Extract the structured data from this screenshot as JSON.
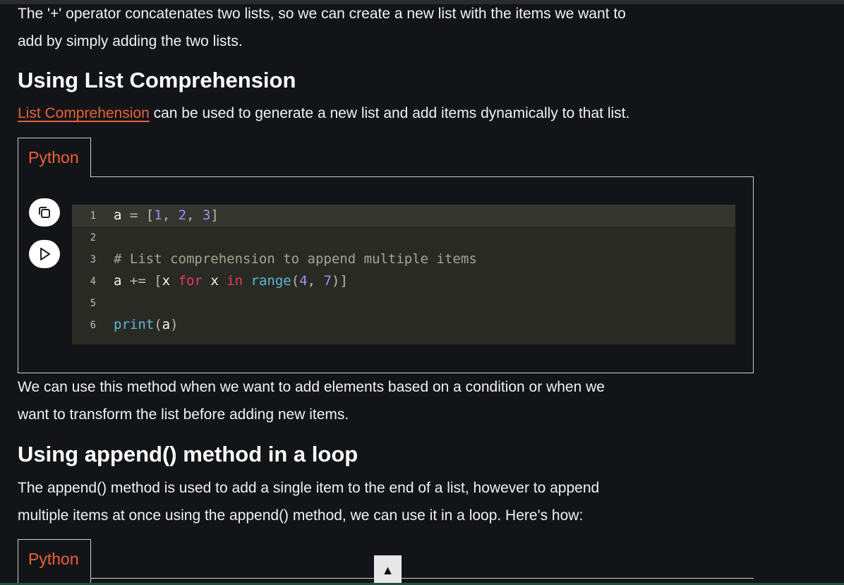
{
  "intro": {
    "line1": "The '+' operator concatenates two lists, so we can create a new list with the items we want to",
    "line2": "add by simply adding the two lists."
  },
  "section1": {
    "heading": "Using List Comprehension",
    "link_text": "List Comprehension",
    "text_after_link": " can be used to generate a new list and add items dynamically to that list.",
    "tab_label": "Python",
    "code_lines": [
      {
        "num": "1"
      },
      {
        "num": "2"
      },
      {
        "num": "3"
      },
      {
        "num": "4"
      },
      {
        "num": "5"
      },
      {
        "num": "6"
      }
    ],
    "after_line1": "We can use this method when we want to add elements based on a condition or when we",
    "after_line2": "want to transform the list before adding new items."
  },
  "code": {
    "l1": {
      "a": "a",
      "eq": " = ",
      "open": "[",
      "n1": "1",
      "c1": ", ",
      "n2": "2",
      "c2": ", ",
      "n3": "3",
      "close": "]"
    },
    "l3": {
      "comment": "# List comprehension to append multiple items"
    },
    "l4": {
      "a": "a",
      "op": " += ",
      "open": "[",
      "x1": "x",
      "for": " for ",
      "x2": "x",
      "in": " in ",
      "range": "range",
      "po": "(",
      "n4": "4",
      "c": ", ",
      "n7": "7",
      "pc": ")",
      "close": "]"
    },
    "l6": {
      "print": "print",
      "po": "(",
      "a": "a",
      "pc": ")"
    }
  },
  "section2": {
    "heading": "Using append() method in a loop",
    "line1": "The append() method is used to add a single item to the end of a list, however to append",
    "line2": "multiple items at once using the append() method, we can use it in a loop. Here's how:",
    "tab_label": "Python"
  },
  "icons": {
    "copy": "copy-icon",
    "run": "play-icon",
    "scroll_top": "arrow-up-icon",
    "scroll_top_glyph": "▲"
  },
  "colors": {
    "background": "#131417",
    "accent": "#e8623a",
    "code_bg": "#2a2a25"
  }
}
